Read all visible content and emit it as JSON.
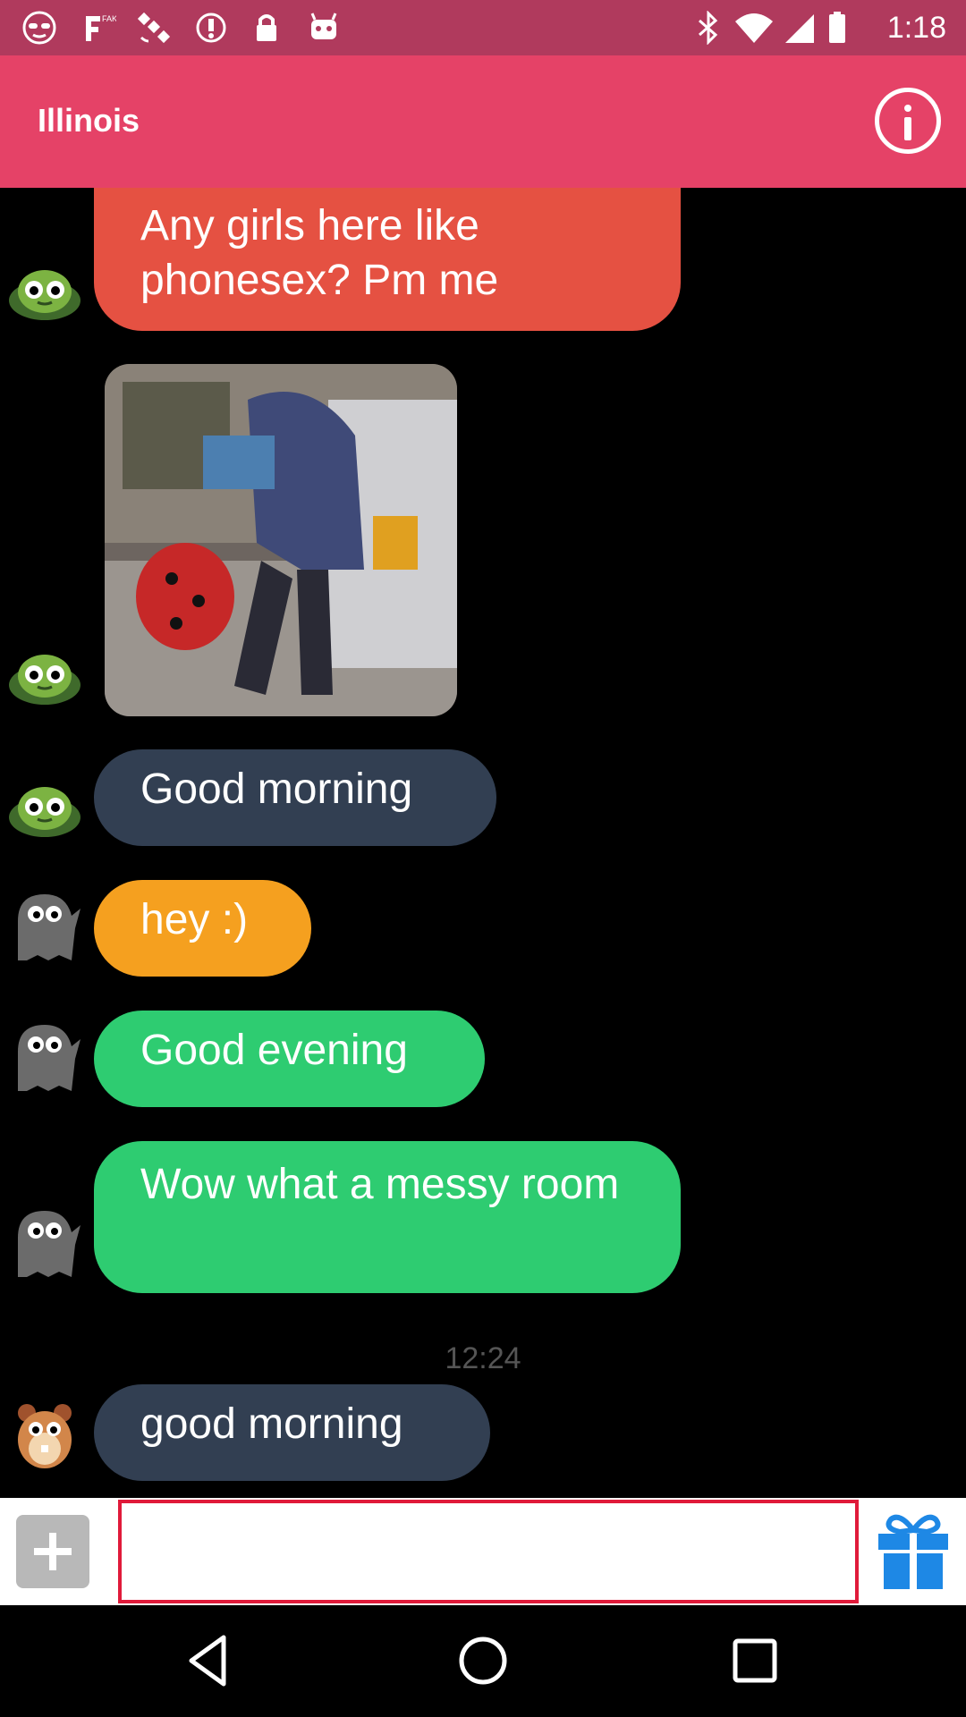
{
  "status_bar": {
    "time": "1:18",
    "icons": [
      "incognito-mask-icon",
      "fake-gps-icon",
      "satellite-icon",
      "settings-notification-icon",
      "lock-icon",
      "android-icon",
      "bluetooth-icon",
      "wifi-icon",
      "signal-icon",
      "battery-icon"
    ]
  },
  "header": {
    "title": "Illinois",
    "info_icon": "info-icon"
  },
  "messages": [
    {
      "avatar": "turtle-avatar",
      "type": "text",
      "text": "Any girls here like phonesex? Pm me",
      "color": "#e55142"
    },
    {
      "avatar": "turtle-avatar",
      "type": "image"
    },
    {
      "avatar": "turtle-avatar",
      "type": "text",
      "text": "Good morning",
      "color": "#323f52"
    },
    {
      "avatar": "ghost-avatar",
      "type": "text",
      "text": "hey :)",
      "color": "#f5a01f"
    },
    {
      "avatar": "ghost-avatar",
      "type": "text",
      "text": "Good evening",
      "color": "#2ecc71"
    },
    {
      "avatar": "ghost-avatar",
      "type": "text",
      "text": "Wow what a messy room",
      "color": "#2ecc71"
    },
    {
      "avatar": "hamster-avatar",
      "type": "text",
      "text": "good morning",
      "color": "#323f52"
    }
  ],
  "timestamp": "12:24",
  "input_bar": {
    "placeholder": "",
    "add_icon": "plus-icon",
    "gift_icon": "gift-icon",
    "gift_color": "#1e88e5",
    "input_border_color": "#e01a3a"
  },
  "nav_bar": [
    "back-icon",
    "home-icon",
    "recents-icon"
  ],
  "colors": {
    "status_bar": "#b03a5d",
    "header": "#e54267",
    "background": "#000000"
  }
}
